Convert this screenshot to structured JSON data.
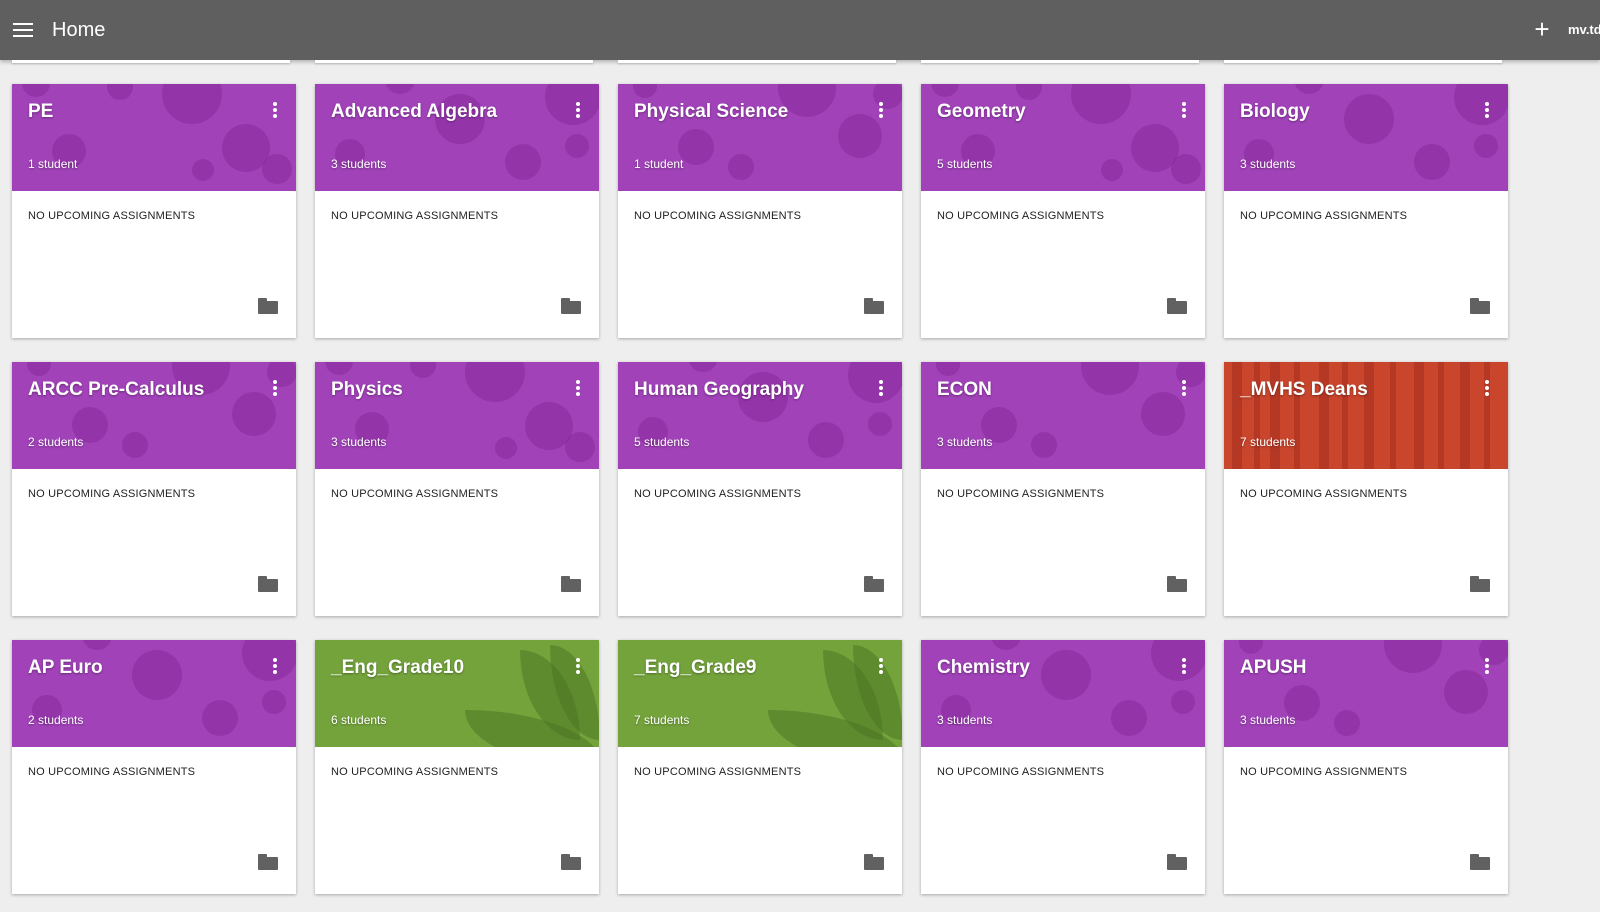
{
  "header": {
    "title": "Home",
    "account": "mv.td",
    "icons": {
      "menu": "hamburger-menu-icon",
      "add": "plus-icon"
    }
  },
  "colors": {
    "topbar": "#5f5f5f",
    "background": "#eeeeee",
    "theme_purple": "#a142b9",
    "theme_red": "#c9452c",
    "theme_green": "#74a33c"
  },
  "classes": [
    {
      "name": "PE",
      "students": "1 student",
      "assignments": "NO UPCOMING ASSIGNMENTS",
      "theme": "purple"
    },
    {
      "name": "Advanced Algebra",
      "students": "3 students",
      "assignments": "NO UPCOMING ASSIGNMENTS",
      "theme": "purple"
    },
    {
      "name": "Physical Science",
      "students": "1 student",
      "assignments": "NO UPCOMING ASSIGNMENTS",
      "theme": "purple"
    },
    {
      "name": "Geometry",
      "students": "5 students",
      "assignments": "NO UPCOMING ASSIGNMENTS",
      "theme": "purple"
    },
    {
      "name": "Biology",
      "students": "3 students",
      "assignments": "NO UPCOMING ASSIGNMENTS",
      "theme": "purple"
    },
    {
      "name": "ARCC Pre-Calculus",
      "students": "2 students",
      "assignments": "NO UPCOMING ASSIGNMENTS",
      "theme": "purple"
    },
    {
      "name": "Physics",
      "students": "3 students",
      "assignments": "NO UPCOMING ASSIGNMENTS",
      "theme": "purple"
    },
    {
      "name": "Human Geography",
      "students": "5 students",
      "assignments": "NO UPCOMING ASSIGNMENTS",
      "theme": "purple"
    },
    {
      "name": "ECON",
      "students": "3 students",
      "assignments": "NO UPCOMING ASSIGNMENTS",
      "theme": "purple"
    },
    {
      "name": "_MVHS Deans",
      "students": "7 students",
      "assignments": "NO UPCOMING ASSIGNMENTS",
      "theme": "red"
    },
    {
      "name": "AP Euro",
      "students": "2 students",
      "assignments": "NO UPCOMING ASSIGNMENTS",
      "theme": "purple"
    },
    {
      "name": "_Eng_Grade10",
      "students": "6 students",
      "assignments": "NO UPCOMING ASSIGNMENTS",
      "theme": "green"
    },
    {
      "name": "_Eng_Grade9",
      "students": "7 students",
      "assignments": "NO UPCOMING ASSIGNMENTS",
      "theme": "green"
    },
    {
      "name": "Chemistry",
      "students": "3 students",
      "assignments": "NO UPCOMING ASSIGNMENTS",
      "theme": "purple"
    },
    {
      "name": "APUSH",
      "students": "3 students",
      "assignments": "NO UPCOMING ASSIGNMENTS",
      "theme": "purple"
    }
  ]
}
